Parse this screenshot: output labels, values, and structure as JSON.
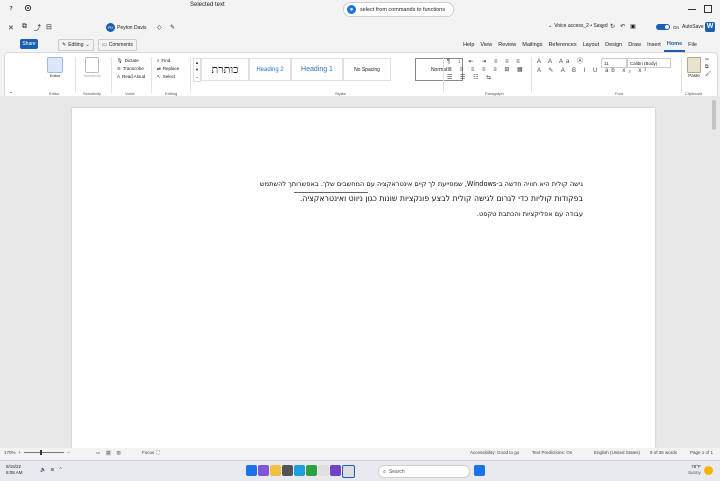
{
  "titlebar": {
    "voice_text": "select from commands to functions",
    "doc_title": "Selected text"
  },
  "qab": {
    "autosave": "AutoSave",
    "toggle_state": "On",
    "filename": "Voice access_2 • Saved",
    "search_placeholder": "Search",
    "user_name": "Peyton Davis",
    "avatar_initials": "PD"
  },
  "tabs": [
    "File",
    "Home",
    "Insert",
    "Draw",
    "Design",
    "Layout",
    "References",
    "Mailings",
    "Review",
    "View",
    "Help"
  ],
  "actions": {
    "share": "Share",
    "editing": "Editing",
    "comments": "Comments"
  },
  "ribbon": {
    "paste": "Paste",
    "font_name": "Calibri (Body)",
    "font_size": "11",
    "styles": {
      "normal": "Normal",
      "no_spacing": "No Spacing",
      "heading1": "Heading 1",
      "heading2": "Heading 2",
      "title": "כותרת"
    },
    "editing": {
      "find": "Find",
      "replace": "Replace",
      "select": "Select"
    },
    "voice": {
      "dictate": "Dictate",
      "transcribe": "Transcribe",
      "read_aloud": "Read Aloud"
    },
    "sensitivity": "Sensitivity",
    "editor": "Editor",
    "groups": {
      "clipboard": "Clipboard",
      "font": "Font",
      "paragraph": "Paragraph",
      "styles": "Styles",
      "editing": "Editing",
      "voice": "Voice",
      "sensitivity": "Sensitivity",
      "editor": "Editor"
    }
  },
  "document": {
    "lines": [
      "גישה קולית היא חוויה חדשה ב-Windows, שמסייעת לך קיים אינטראקציה עם המחשבים שלך. באפשרותך להשתמש",
      "בפקודות קוליות כדי לגרום לגישה קולית לבצע פונקציות שונות כגון ניווט ואינטראקציה.",
      "עבודה עם אפליקציות והכתבת טקסט."
    ]
  },
  "status": {
    "page": "Page 1 of 1",
    "words": "8 of 35 words",
    "language": "English (United States)",
    "text_predictions": "Text Predictions: On",
    "accessibility": "Accessibility: Good to go",
    "focus": "Focus",
    "zoom": "170%"
  },
  "taskbar": {
    "search_placeholder": "Search",
    "weather_temp": "78°F",
    "weather_cond": "Sunny",
    "time": "8:08 AM",
    "date": "9/15/22"
  },
  "colors": {
    "accent": "#1a5fb4",
    "ribbon_bg": "#ffffff",
    "page": "#ffffff"
  }
}
